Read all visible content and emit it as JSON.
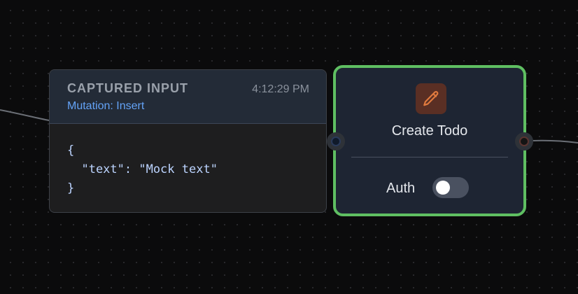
{
  "captured_input": {
    "title": "CAPTURED INPUT",
    "subtitle": "Mutation: Insert",
    "timestamp": "4:12:29 PM",
    "code_lines": [
      "{",
      "  \"text\": \"Mock text\"",
      "}"
    ]
  },
  "node": {
    "title": "Create Todo",
    "icon": "pencil-icon",
    "icon_color": "#e07a3e",
    "auth_label": "Auth",
    "auth_enabled": false,
    "border_color": "#5fbf62"
  }
}
